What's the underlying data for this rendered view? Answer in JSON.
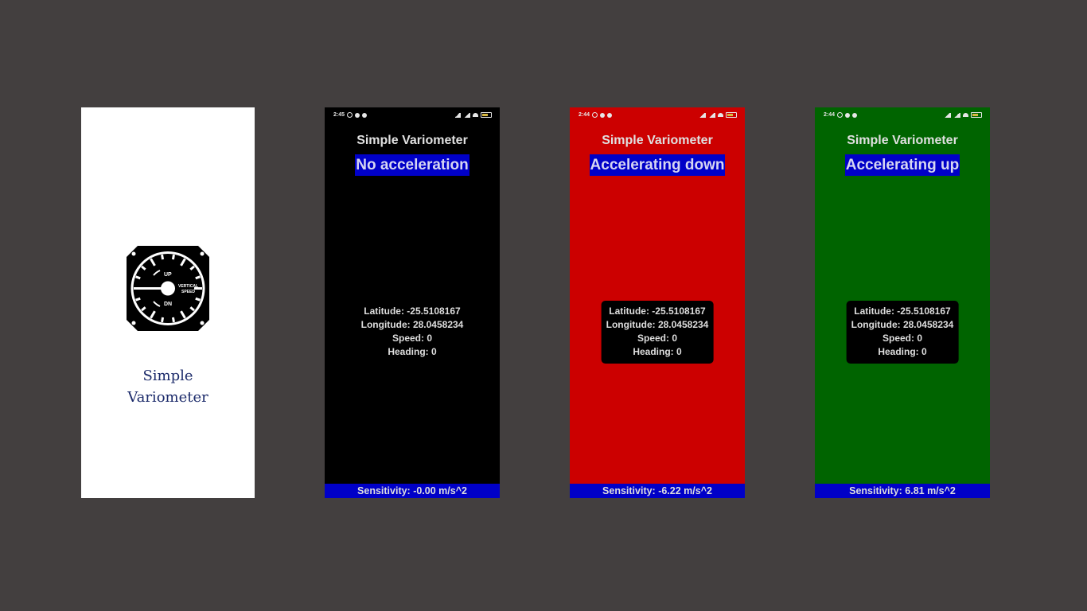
{
  "splash": {
    "title_line1": "Simple",
    "title_line2": "Variometer",
    "gauge_up": "UP",
    "gauge_dn": "DN",
    "gauge_label1": "VERTICAL",
    "gauge_label2": "SPEED"
  },
  "screens": [
    {
      "id": "black",
      "time": "2:45",
      "app_title": "Simple Variometer",
      "state": "No acceleration",
      "latitude": "Latitude: -25.5108167",
      "longitude": "Longitude: 28.0458234",
      "speed": "Speed: 0",
      "heading": "Heading: 0",
      "sensitivity": "Sensitivity: -0.00 m/s^2",
      "background": "#000000"
    },
    {
      "id": "red",
      "time": "2:44",
      "app_title": "Simple Variometer",
      "state": "Accelerating down",
      "latitude": "Latitude: -25.5108167",
      "longitude": "Longitude: 28.0458234",
      "speed": "Speed: 0",
      "heading": "Heading: 0",
      "sensitivity": "Sensitivity: -6.22 m/s^2",
      "background": "#cc0000"
    },
    {
      "id": "green",
      "time": "2:44",
      "app_title": "Simple Variometer",
      "state": "Accelerating up",
      "latitude": "Latitude: -25.5108167",
      "longitude": "Longitude: 28.0458234",
      "speed": "Speed: 0",
      "heading": "Heading: 0",
      "sensitivity": "Sensitivity: 6.81 m/s^2",
      "background": "#006400"
    }
  ],
  "colors": {
    "page_background": "#433f3f",
    "accent_blue": "#0000c8",
    "splash_text": "#1b2a6a"
  },
  "icons": {
    "gauge": "vertical-speed-gauge-icon",
    "status_alarm": "alarm-icon",
    "status_app": "app-notification-icon",
    "status_signal": "signal-bars-icon",
    "status_wifi": "wifi-icon",
    "status_battery": "battery-icon"
  }
}
